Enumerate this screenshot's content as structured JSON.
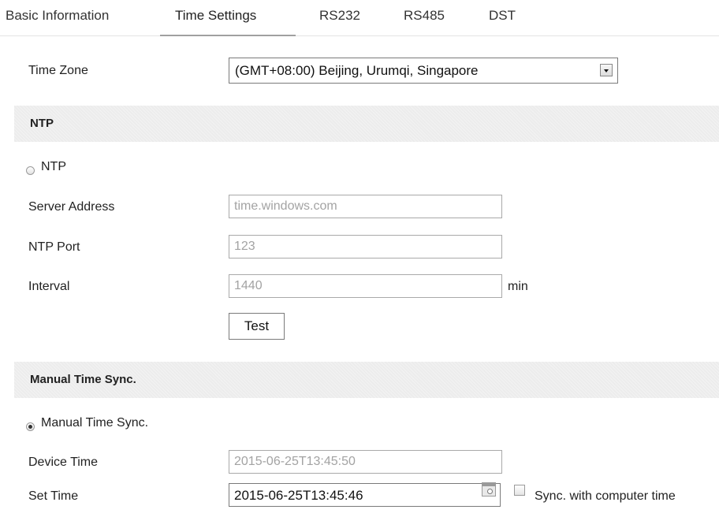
{
  "tabs": [
    {
      "label": "Basic Information"
    },
    {
      "label": "Time Settings",
      "active": true
    },
    {
      "label": "RS232"
    },
    {
      "label": "RS485"
    },
    {
      "label": "DST"
    }
  ],
  "time_zone": {
    "label": "Time Zone",
    "value": "(GMT+08:00) Beijing, Urumqi, Singapore"
  },
  "ntp": {
    "section_title": "NTP",
    "radio_label": "NTP",
    "radio_checked": false,
    "server_address_label": "Server Address",
    "server_address_value": "time.windows.com",
    "port_label": "NTP Port",
    "port_value": "123",
    "interval_label": "Interval",
    "interval_value": "1440",
    "interval_unit": "min",
    "test_button": "Test"
  },
  "manual": {
    "section_title": "Manual Time Sync.",
    "radio_label": "Manual Time Sync.",
    "radio_checked": true,
    "device_time_label": "Device Time",
    "device_time_value": "2015-06-25T13:45:50",
    "set_time_label": "Set Time",
    "set_time_value": "2015-06-25T13:45:46",
    "sync_checkbox_label": "Sync. with computer time",
    "sync_checked": false
  },
  "icons": {
    "dropdown": "chevron-down-icon",
    "calendar": "calendar-icon"
  }
}
